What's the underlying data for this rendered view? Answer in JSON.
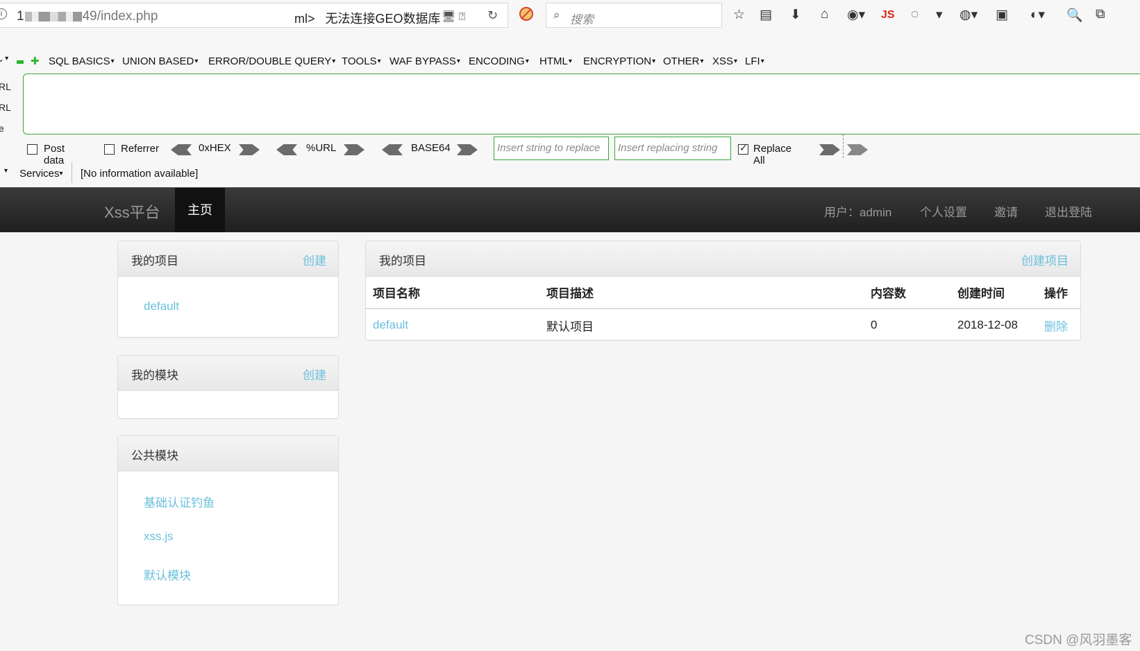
{
  "browser": {
    "url_prefix": "1",
    "url_suffix": "49/index.php",
    "url_overlay": "ml>",
    "geo_status": "无法连接GEO数据库",
    "search_placeholder": "搜索",
    "js_label": "JS"
  },
  "hackbar": {
    "menu": [
      "SQL BASICS",
      "UNION BASED",
      "ERROR/DOUBLE QUERY",
      "TOOLS",
      "WAF BYPASS",
      "ENCODING",
      "HTML",
      "ENCRYPTION",
      "OTHER",
      "XSS",
      "LFI"
    ],
    "left_labels": [
      "RL",
      "RL",
      "e"
    ],
    "post_data_label": "Post data",
    "referrer_label": "Referrer",
    "hex_label": "0xHEX",
    "url_label": "%URL",
    "base64_label": "BASE64",
    "replace_placeholder": "Insert string to replace",
    "replacing_placeholder": "Insert replacing string",
    "replace_all_label": "Replace All",
    "replace_all_checked": true,
    "services_label": "Services",
    "info_text": "[No information available]"
  },
  "navbar": {
    "brand": "Xss平台",
    "home": "主页",
    "user": "用户：admin",
    "settings": "个人设置",
    "invite": "邀请",
    "logout": "退出登陆"
  },
  "my_projects_panel": {
    "title": "我的项目",
    "create": "创建",
    "items": [
      "default"
    ]
  },
  "my_modules_panel": {
    "title": "我的模块",
    "create": "创建"
  },
  "public_modules_panel": {
    "title": "公共模块",
    "items": [
      "基础认证钓鱼",
      "xss.js",
      "默认模块"
    ]
  },
  "projects_table": {
    "title": "我的项目",
    "create": "创建项目",
    "headers": [
      "项目名称",
      "项目描述",
      "内容数",
      "创建时间",
      "操作"
    ],
    "rows": [
      {
        "name": "default",
        "description": "默认项目",
        "count": "0",
        "created": "2018-12-08",
        "action": "删除"
      }
    ]
  },
  "watermark": "CSDN @风羽墨客",
  "colors": {
    "link": "#6cc0dd",
    "hackbar_green": "#3aa33a",
    "navbar": "#222222"
  }
}
